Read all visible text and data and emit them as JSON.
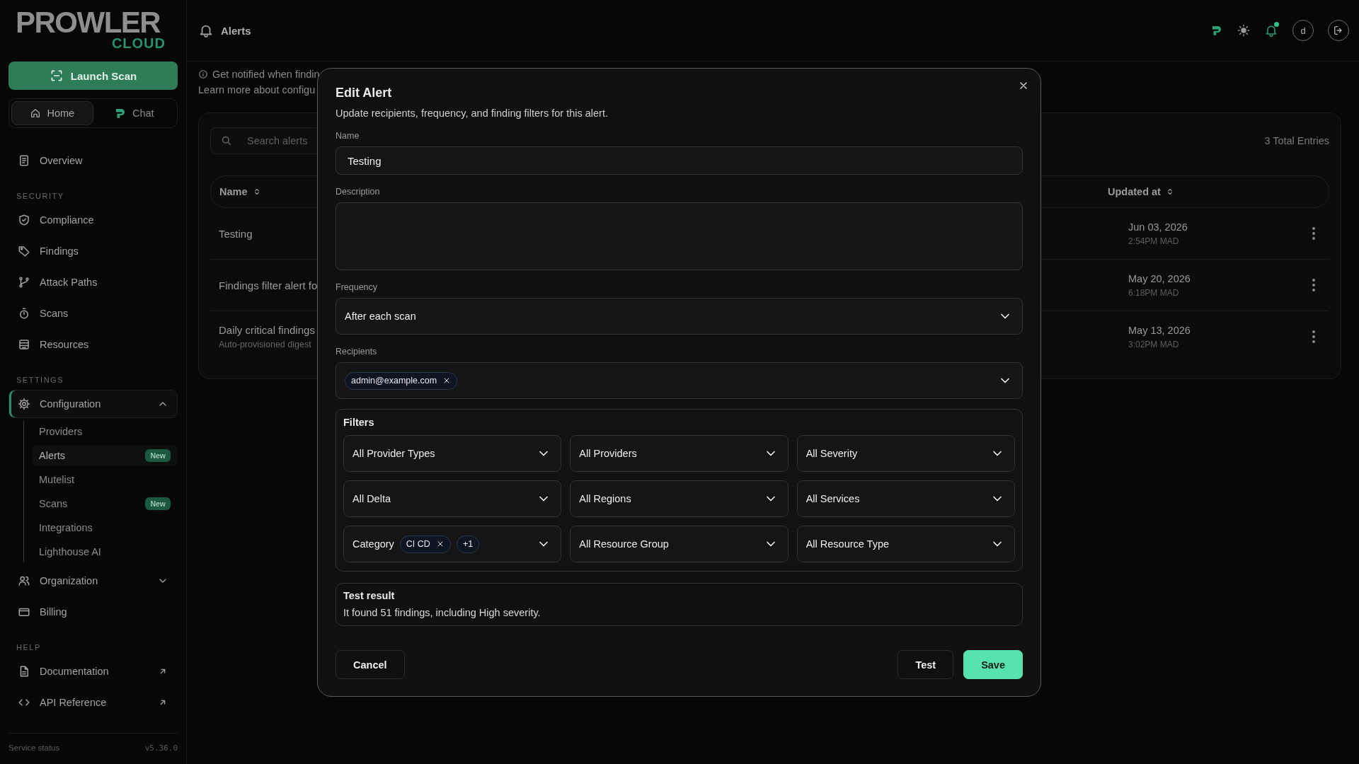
{
  "sidebar": {
    "logo_word": "PROWLER",
    "logo_sub": "CLOUD",
    "launch_button": "Launch Scan",
    "switch": [
      {
        "label": "Home",
        "selected": true
      },
      {
        "label": "Chat",
        "selected": false
      }
    ],
    "groups": [
      {
        "items": [
          {
            "label": "Overview",
            "selected": false
          }
        ]
      },
      {
        "heading": "SECURITY",
        "items": [
          {
            "label": "Compliance",
            "selected": false
          },
          {
            "label": "Findings",
            "selected": false
          },
          {
            "label": "Attack Paths",
            "selected": false
          },
          {
            "label": "Scans",
            "selected": false
          },
          {
            "label": "Resources",
            "selected": false
          }
        ]
      },
      {
        "heading": "SETTINGS",
        "items": [
          {
            "label": "Configuration",
            "selected": true,
            "expanded": true,
            "children": [
              {
                "label": "Providers",
                "selected": false
              },
              {
                "label": "Alerts",
                "selected": true,
                "badge": "New"
              },
              {
                "label": "Mutelist",
                "selected": false
              },
              {
                "label": "Scans",
                "selected": false,
                "badge": "New"
              },
              {
                "label": "Integrations",
                "selected": false
              },
              {
                "label": "Lighthouse AI",
                "selected": false
              }
            ]
          },
          {
            "label": "Organization",
            "selected": false,
            "expanded": false
          },
          {
            "label": "Billing",
            "selected": false
          }
        ]
      },
      {
        "heading": "HELP",
        "items": [
          {
            "label": "Documentation",
            "selected": false,
            "external": true
          },
          {
            "label": "API Reference",
            "selected": false,
            "external": true
          }
        ]
      }
    ],
    "footer": {
      "status": "Service status",
      "version": "v5.36.0"
    }
  },
  "topbar": {
    "title": "Alerts",
    "avatar": "d",
    "unread": true
  },
  "page": {
    "intro": [
      "Get notified when findin",
      "Learn more about configu"
    ],
    "search": {
      "placeholder": "Search alerts"
    },
    "total": "3 Total Entries",
    "columns": [
      "Name",
      "Updated at"
    ],
    "rows": [
      {
        "name": "Testing",
        "date": "Jun 03, 2026",
        "time": "2:54PM MAD"
      },
      {
        "name": "Findings filter alert fo",
        "date": "May 20, 2026",
        "time": "6:18PM MAD"
      },
      {
        "name": "Daily critical findings",
        "subtitle": "Auto-provisioned digest",
        "date": "May 13, 2026",
        "time": "3:02PM MAD"
      }
    ]
  },
  "dialog": {
    "title": "Edit Alert",
    "subtitle": "Update recipients, frequency, and finding filters for this alert.",
    "fields": [
      {
        "kind": "text",
        "label": "Name",
        "value": "Testing"
      },
      {
        "kind": "textarea",
        "label": "Description"
      },
      {
        "kind": "select",
        "label": "Frequency",
        "value": "After each scan"
      },
      {
        "kind": "chips",
        "label": "Recipients",
        "chips": [
          "admin@example.com"
        ]
      }
    ],
    "filters": {
      "title": "Filters",
      "items": [
        {
          "value": "All Provider Types"
        },
        {
          "value": "All Providers"
        },
        {
          "value": "All Severity"
        },
        {
          "value": "All Delta"
        },
        {
          "value": "All Regions"
        },
        {
          "value": "All Services"
        },
        {
          "label": "Category",
          "chips": [
            "CI CD"
          ],
          "more": "+1"
        },
        {
          "value": "All Resource Group"
        },
        {
          "value": "All Resource Type"
        }
      ]
    },
    "test_result": {
      "title": "Test result",
      "text": "It found 51 findings, including High severity."
    },
    "buttons": [
      {
        "kind": "secondary",
        "label": "Cancel"
      },
      {
        "kind": "secondary",
        "label": "Test"
      },
      {
        "kind": "primary",
        "label": "Save"
      }
    ]
  }
}
